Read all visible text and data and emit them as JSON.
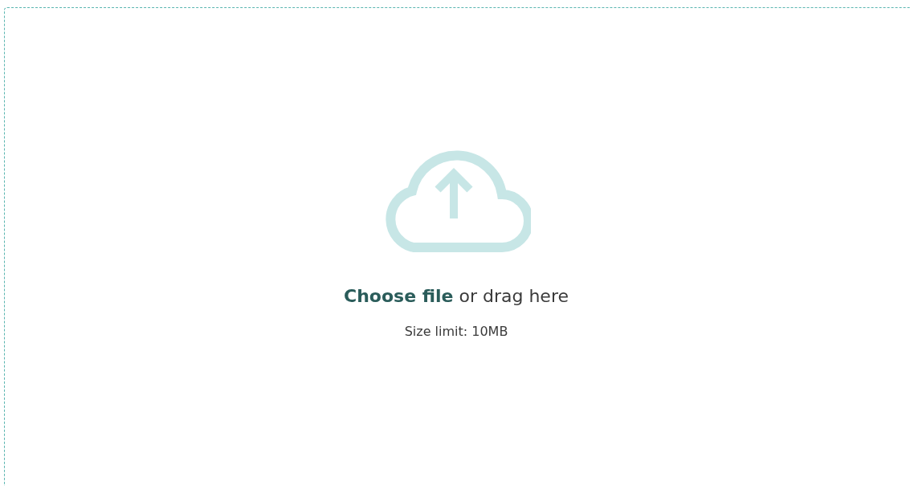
{
  "dropzone": {
    "link": "Choose file",
    "text": "or drag here",
    "size_limit": "Size limit: 10MB"
  }
}
